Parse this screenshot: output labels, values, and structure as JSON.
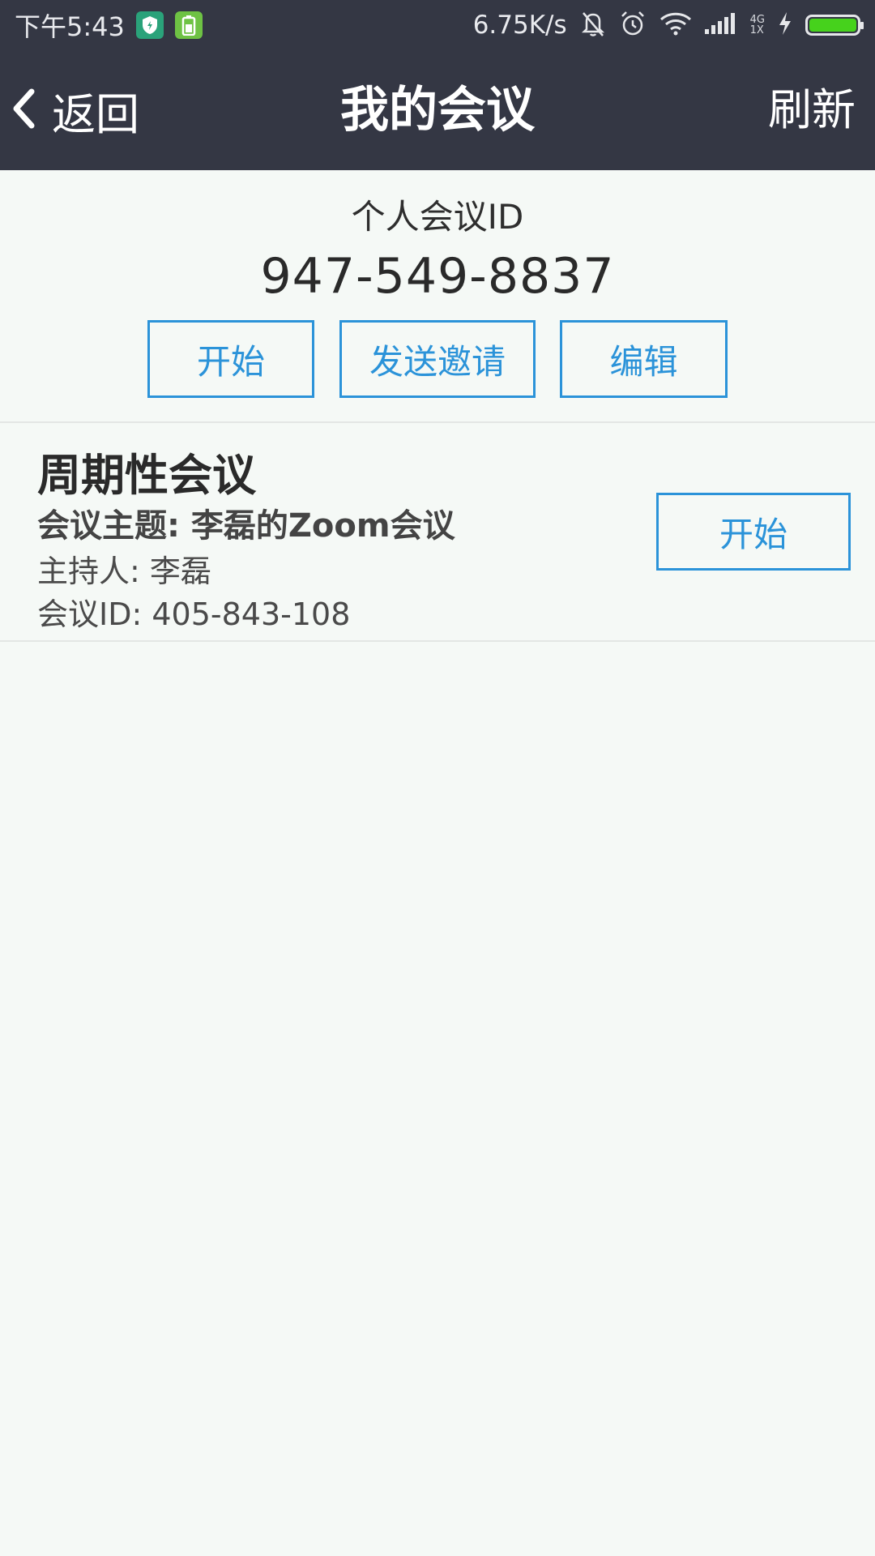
{
  "status_bar": {
    "time": "下午5:43",
    "speed": "6.75K/s",
    "net_top": "4G",
    "net_bottom": "1X",
    "battery_color": "#46d21c",
    "icons": [
      "shield-app-icon",
      "battery-app-icon",
      "mute-bell-icon",
      "alarm-icon",
      "wifi-icon",
      "signal-icon",
      "charging-icon",
      "battery-icon"
    ]
  },
  "header": {
    "back_label": "返回",
    "title": "我的会议",
    "refresh_label": "刷新",
    "background": "#343744"
  },
  "personal_meeting": {
    "label": "个人会议ID",
    "id": "947-549-8837",
    "start_label": "开始",
    "invite_label": "发送邀请",
    "edit_label": "编辑"
  },
  "recurring_meeting": {
    "heading": "周期性会议",
    "topic": "会议主题: 李磊的Zoom会议",
    "host": "主持人: 李磊",
    "meeting_id": "会议ID: 405-843-108",
    "start_label": "开始"
  },
  "colors": {
    "accent": "#2b93d9",
    "page_background": "#f5f9f6"
  }
}
